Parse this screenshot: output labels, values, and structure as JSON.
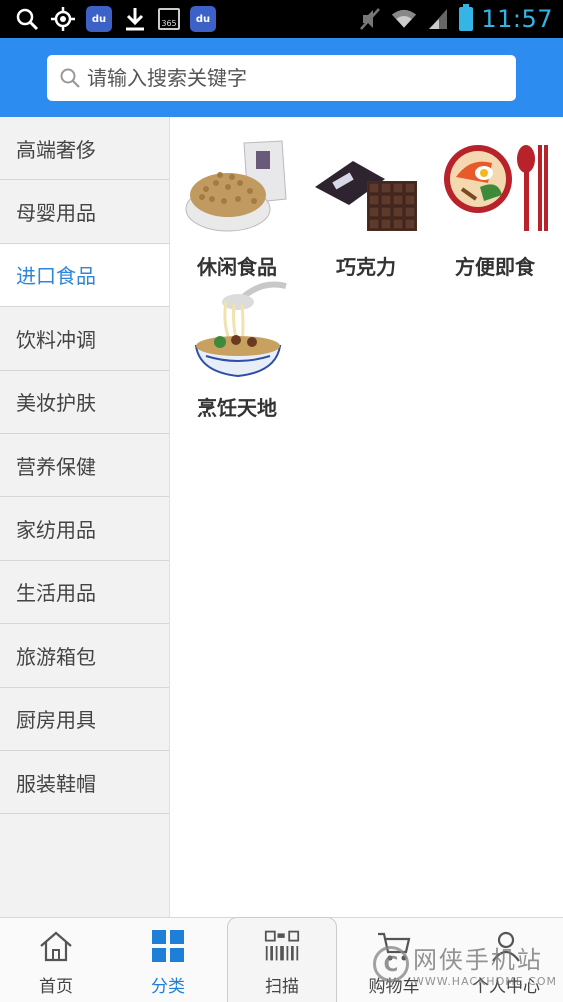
{
  "status_bar": {
    "time": "11:57",
    "icons": [
      "search-icon",
      "location-icon",
      "baidu-icon",
      "download-icon",
      "calendar-icon",
      "baidu-icon",
      "mute-icon",
      "wifi-icon",
      "signal-icon",
      "battery-icon"
    ],
    "calendar_text": "365",
    "baidu_text": "du"
  },
  "search": {
    "placeholder": "请输入搜索关键字"
  },
  "sidebar": {
    "items": [
      {
        "label": "高端奢侈"
      },
      {
        "label": "母婴用品"
      },
      {
        "label": "进口食品",
        "active": true
      },
      {
        "label": "饮料冲调"
      },
      {
        "label": "美妆护肤"
      },
      {
        "label": "营养保健"
      },
      {
        "label": "家纺用品"
      },
      {
        "label": "生活用品"
      },
      {
        "label": "旅游箱包"
      },
      {
        "label": "厨房用具"
      },
      {
        "label": "服装鞋帽"
      }
    ]
  },
  "categories": [
    {
      "label": "休闲食品",
      "image": "snack-food-image"
    },
    {
      "label": "巧克力",
      "image": "chocolate-image"
    },
    {
      "label": "方便即食",
      "image": "instant-food-image"
    },
    {
      "label": "烹饪天地",
      "image": "cooking-image"
    }
  ],
  "bottom_nav": {
    "items": [
      {
        "label": "首页",
        "icon": "home-icon"
      },
      {
        "label": "分类",
        "icon": "grid-icon",
        "active": true
      },
      {
        "label": "扫描",
        "icon": "barcode-icon"
      },
      {
        "label": "购物车",
        "icon": "cart-icon"
      },
      {
        "label": "个人中心",
        "icon": "user-icon"
      }
    ]
  },
  "watermark": {
    "cn": "网侠手机站",
    "en": "WWW.HACKHOME.COM",
    "logo": "C"
  },
  "colors": {
    "header": "#2d8cf0",
    "active_text": "#2f86d8",
    "clock": "#34b5e5"
  }
}
